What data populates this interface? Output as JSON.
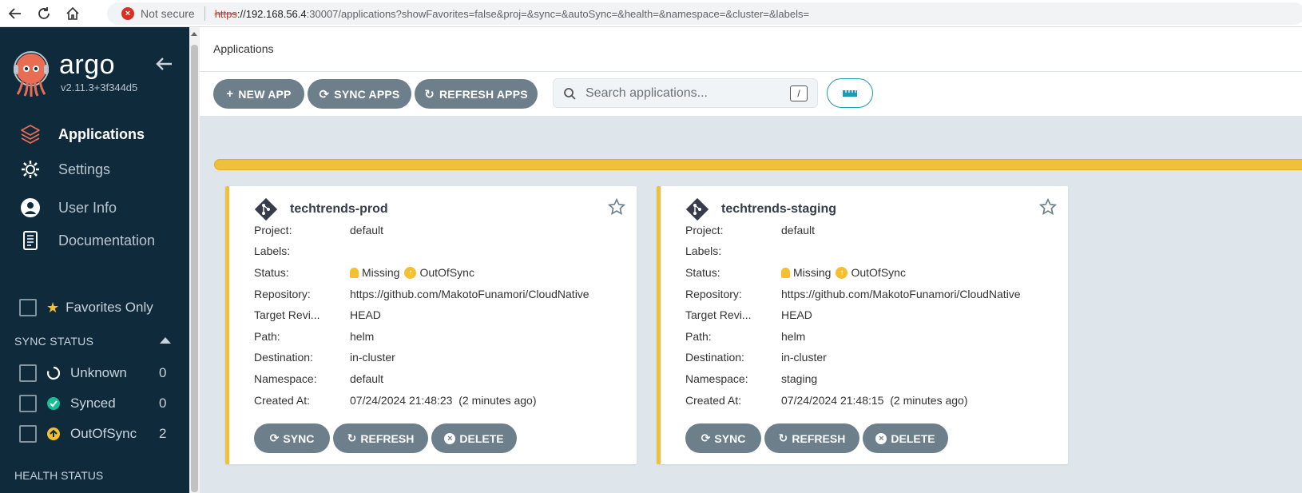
{
  "browser": {
    "security_label": "Not secure",
    "url_scheme": "https",
    "url_host": "://192.168.56.4",
    "url_rest": ":30007/applications?showFavorites=false&proj=&sync=&autoSync=&health=&namespace=&cluster=&labels="
  },
  "sidebar": {
    "brand_name": "argo",
    "version": "v2.11.3+3f344d5",
    "nav": [
      {
        "label": "Applications",
        "icon": "layers-icon",
        "active": true
      },
      {
        "label": "Settings",
        "icon": "gear-icon",
        "active": false
      },
      {
        "label": "User Info",
        "icon": "user-icon",
        "active": false
      },
      {
        "label": "Documentation",
        "icon": "book-icon",
        "active": false
      }
    ],
    "favorites_label": "Favorites Only",
    "sync_status_heading": "SYNC STATUS",
    "sync_filters": [
      {
        "label": "Unknown",
        "count": "0",
        "icon": "circle-notch-icon"
      },
      {
        "label": "Synced",
        "count": "0",
        "icon": "check-circle-icon"
      },
      {
        "label": "OutOfSync",
        "count": "2",
        "icon": "arrow-up-circle-icon"
      }
    ],
    "health_status_heading": "HEALTH STATUS"
  },
  "header": {
    "title": "Applications"
  },
  "toolbar": {
    "new_app": "NEW APP",
    "sync_apps": "SYNC APPS",
    "refresh_apps": "REFRESH APPS",
    "search_placeholder": "Search applications...",
    "search_shortcut": "/"
  },
  "colors": {
    "sidebar_bg": "#0e2a3b",
    "button_bg": "#6d7f8b",
    "out_of_sync": "#f4c030",
    "synced": "#18be94",
    "accent": "#1d9bb4"
  },
  "labels": {
    "project": "Project:",
    "labels": "Labels:",
    "status": "Status:",
    "repository": "Repository:",
    "target_revision": "Target Revi...",
    "path": "Path:",
    "destination": "Destination:",
    "namespace": "Namespace:",
    "created_at": "Created At:",
    "sync_btn": "SYNC",
    "refresh_btn": "REFRESH",
    "delete_btn": "DELETE"
  },
  "apps": [
    {
      "name": "techtrends-prod",
      "project": "default",
      "labels": "",
      "health": "Missing",
      "sync": "OutOfSync",
      "repository": "https://github.com/MakotoFunamori/CloudNative",
      "target_revision": "HEAD",
      "path": "helm",
      "destination": "in-cluster",
      "namespace": "default",
      "created_at": "07/24/2024 21:48:23  (2 minutes ago)"
    },
    {
      "name": "techtrends-staging",
      "project": "default",
      "labels": "",
      "health": "Missing",
      "sync": "OutOfSync",
      "repository": "https://github.com/MakotoFunamori/CloudNative",
      "target_revision": "HEAD",
      "path": "helm",
      "destination": "in-cluster",
      "namespace": "staging",
      "created_at": "07/24/2024 21:48:15  (2 minutes ago)"
    }
  ]
}
